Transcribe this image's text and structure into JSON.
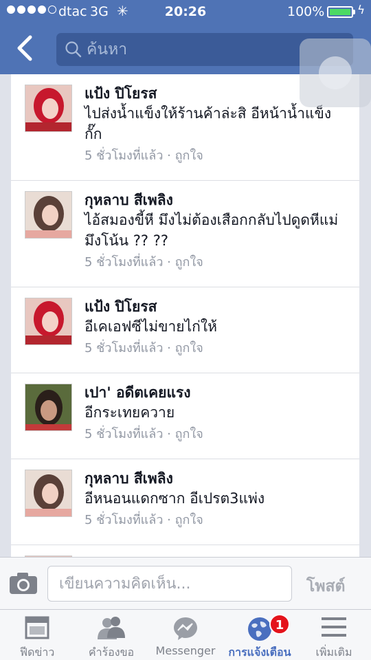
{
  "status_bar": {
    "carrier": "dtac",
    "network": "3G",
    "time": "20:26",
    "battery": "100%",
    "battery_level": 1.0,
    "battery_color": "#4cd964",
    "signal_bars_filled": 4
  },
  "nav": {
    "search_placeholder": "ค้นหา",
    "accent": "#4f73b5"
  },
  "notifications": [
    {
      "name": "แป้ง ปิโยรส",
      "text": "ไปส่งน้ำแข็งให้ร้านค้าล่ะสิ อีหน้าน้ำแข็งกั๊ก",
      "time": "5 ชั่วโมงที่แล้ว",
      "like": "ถูกใจ"
    },
    {
      "name": "กุหลาบ สีเพลิง",
      "text": "ไอ้สมองขี้หี มึงไม่ต้องเสือกกลับไปดูดหีแม่มึงโน้น ?? ??",
      "time": "5 ชั่วโมงที่แล้ว",
      "like": "ถูกใจ"
    },
    {
      "name": "แป้ง ปิโยรส",
      "text": "อีเคเอฟซีไม่ขายไก่ให้",
      "time": "5 ชั่วโมงที่แล้ว",
      "like": "ถูกใจ"
    },
    {
      "name": "เปา' อดีตเคยแรง",
      "text": "อีกระเทยควาย",
      "time": "5 ชั่วโมงที่แล้ว",
      "like": "ถูกใจ"
    },
    {
      "name": "กุหลาบ สีเพลิง",
      "text": "อีหนอนแดกซาก อีเปรต3แพ่ง",
      "time": "5 ชั่วโมงที่แล้ว",
      "like": "ถูกใจ"
    }
  ],
  "separator": "·",
  "composer": {
    "placeholder": "เขียนความคิดเห็น...",
    "post_label": "โพสต์"
  },
  "tabs": [
    {
      "label": "ฟีดข่าว",
      "icon": "news-feed-icon"
    },
    {
      "label": "คำร้องขอ",
      "icon": "friend-requests-icon"
    },
    {
      "label": "Messenger",
      "icon": "messenger-icon"
    },
    {
      "label": "การแจ้งเตือน",
      "icon": "globe-icon",
      "badge": "1",
      "active": true
    },
    {
      "label": "เพิ่มเติม",
      "icon": "menu-icon"
    }
  ]
}
